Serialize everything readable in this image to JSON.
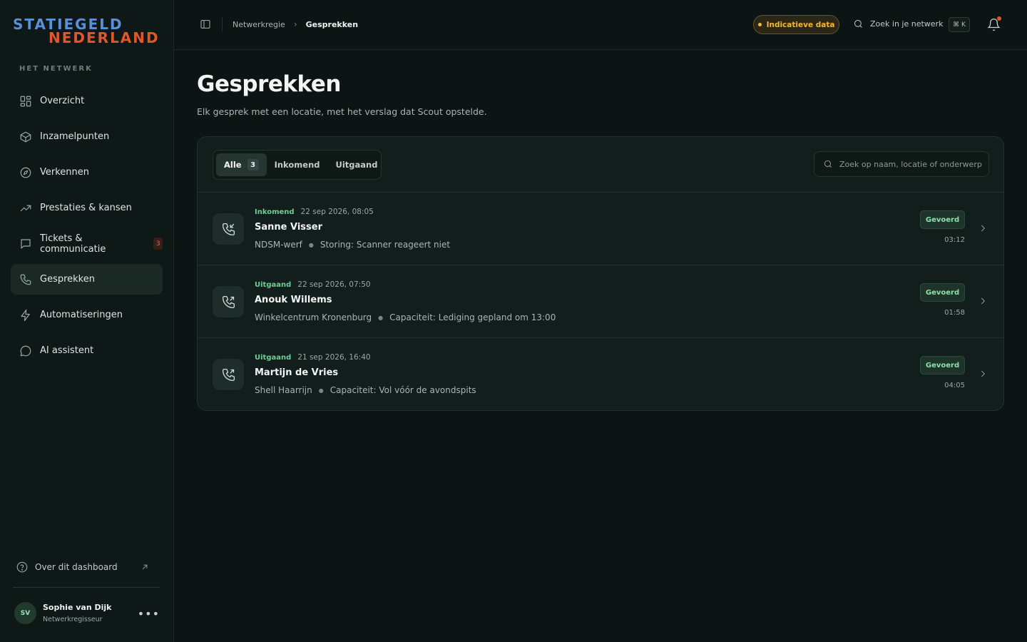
{
  "brand": {
    "line1": "STATIEGELD",
    "line2": "NEDERLAND"
  },
  "sidebar": {
    "section_label": "HET NETWERK",
    "items": [
      {
        "label": "Overzicht",
        "icon": "grid-icon"
      },
      {
        "label": "Inzamelpunten",
        "icon": "box-icon"
      },
      {
        "label": "Verkennen",
        "icon": "compass-icon"
      },
      {
        "label": "Prestaties & kansen",
        "icon": "trend-up-icon"
      },
      {
        "label": "Tickets & communicatie",
        "icon": "message-square-icon",
        "badge": "3"
      },
      {
        "label": "Gesprekken",
        "icon": "phone-icon",
        "active": true
      },
      {
        "label": "Automatiseringen",
        "icon": "zap-icon"
      },
      {
        "label": "AI assistent",
        "icon": "chat-bubble-icon"
      }
    ],
    "about_label": "Over dit dashboard",
    "user": {
      "initials": "SV",
      "name": "Sophie van Dijk",
      "role": "Netwerkregisseur"
    }
  },
  "topbar": {
    "breadcrumb": [
      "Netwerkregie",
      "Gesprekken"
    ],
    "indicative_label": "Indicatieve data",
    "search_label": "Zoek in je netwerk",
    "shortcut": "⌘ K"
  },
  "main": {
    "title": "Gesprekken",
    "subtitle": "Elk gesprek met een locatie, met het verslag dat Scout opstelde.",
    "tabs": [
      {
        "label": "Alle",
        "count": "3",
        "active": true
      },
      {
        "label": "Inkomend"
      },
      {
        "label": "Uitgaand"
      }
    ],
    "search_placeholder": "Zoek op naam, locatie of onderwerp",
    "calls": [
      {
        "direction": "Inkomend",
        "datetime": "22 sep 2026, 08:05",
        "name": "Sanne Visser",
        "location": "NDSM-werf",
        "subject": "Storing: Scanner reageert niet",
        "status": "Gevoerd",
        "duration": "03:12",
        "icon": "phone-incoming-icon"
      },
      {
        "direction": "Uitgaand",
        "datetime": "22 sep 2026, 07:50",
        "name": "Anouk Willems",
        "location": "Winkelcentrum Kronenburg",
        "subject": "Capaciteit: Lediging gepland om 13:00",
        "status": "Gevoerd",
        "duration": "01:58",
        "icon": "phone-outgoing-icon"
      },
      {
        "direction": "Uitgaand",
        "datetime": "21 sep 2026, 16:40",
        "name": "Martijn de Vries",
        "location": "Shell Haarrijn",
        "subject": "Capaciteit: Vol vóór de avondspits",
        "status": "Gevoerd",
        "duration": "04:05",
        "icon": "phone-outgoing-icon"
      }
    ]
  },
  "colors": {
    "background": "#0c1513",
    "accent_green": "#6fcf97",
    "brand_blue": "#5b8fd8",
    "brand_orange": "#e2562c",
    "warning": "#f0b93a"
  }
}
